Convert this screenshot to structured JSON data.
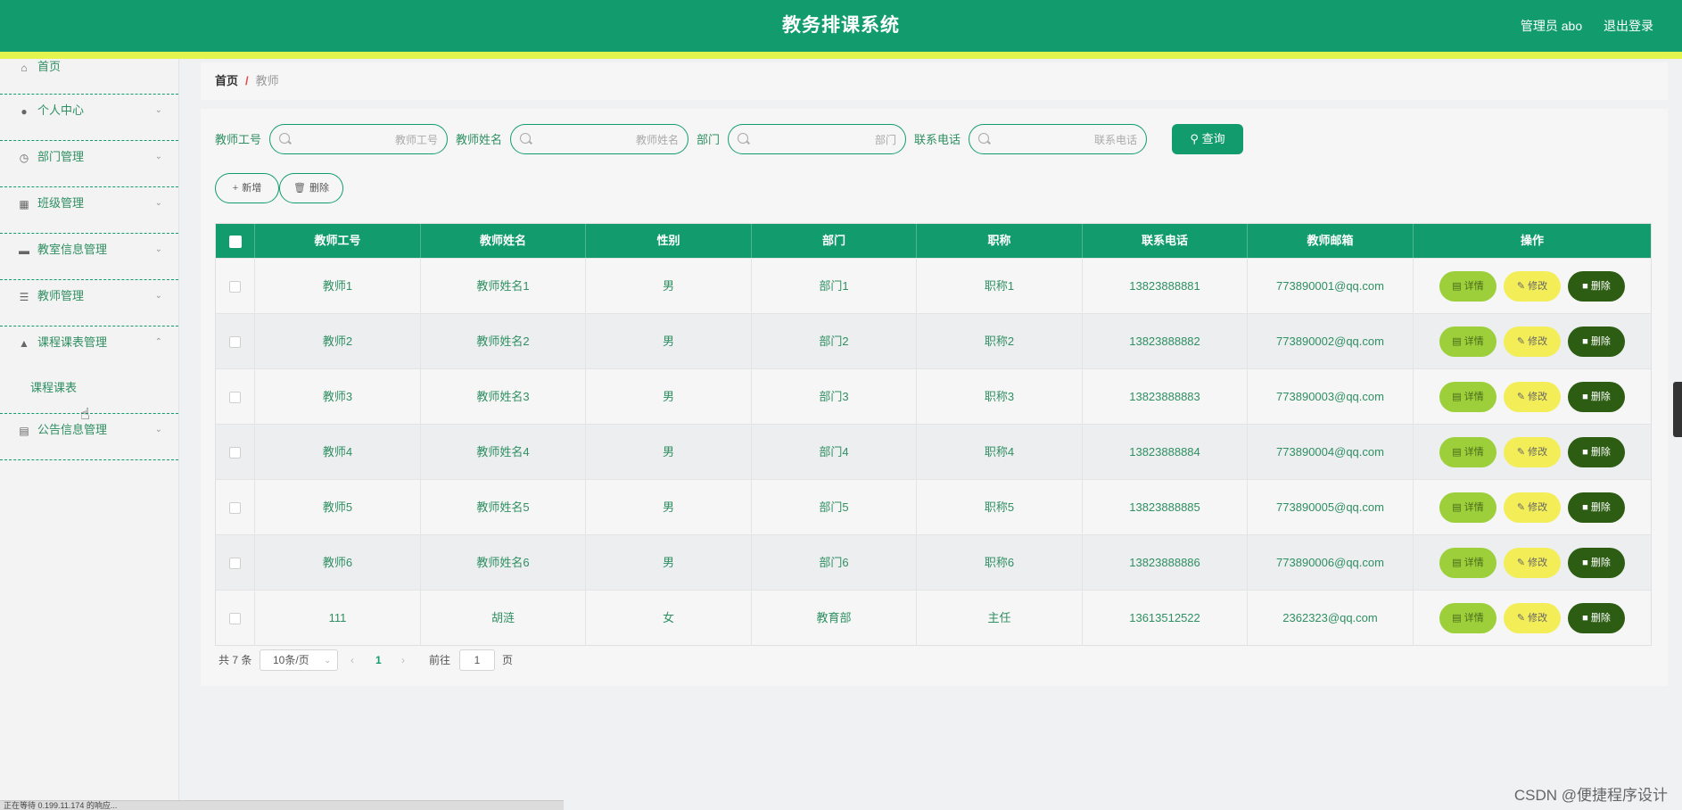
{
  "header": {
    "title": "教务排课系统",
    "user": "管理员 abo",
    "logout": "退出登录"
  },
  "sidebar": {
    "items": [
      {
        "label": "首页",
        "icon": "home-icon"
      },
      {
        "label": "个人中心",
        "icon": "user-icon"
      },
      {
        "label": "部门管理",
        "icon": "clock-icon"
      },
      {
        "label": "班级管理",
        "icon": "grid-icon"
      },
      {
        "label": "教室信息管理",
        "icon": "monitor-icon"
      },
      {
        "label": "教师管理",
        "icon": "sliders-icon"
      },
      {
        "label": "课程课表管理",
        "icon": "stamp-icon",
        "expanded": true,
        "children": [
          "课程课表"
        ]
      },
      {
        "label": "公告信息管理",
        "icon": "clipboard-icon"
      }
    ]
  },
  "breadcrumb": {
    "home": "首页",
    "separator": "/",
    "current": "教师"
  },
  "search": {
    "fields": [
      {
        "label": "教师工号",
        "placeholder": "教师工号"
      },
      {
        "label": "教师姓名",
        "placeholder": "教师姓名"
      },
      {
        "label": "部门",
        "placeholder": "部门"
      },
      {
        "label": "联系电话",
        "placeholder": "联系电话"
      }
    ],
    "query_label": "查询"
  },
  "toolbar": {
    "add_label": "新增",
    "delete_label": "删除"
  },
  "table": {
    "columns": [
      "教师工号",
      "教师姓名",
      "性别",
      "部门",
      "职称",
      "联系电话",
      "教师邮箱",
      "操作"
    ],
    "rows": [
      [
        "教师1",
        "教师姓名1",
        "男",
        "部门1",
        "职称1",
        "13823888881",
        "773890001@qq.com"
      ],
      [
        "教师2",
        "教师姓名2",
        "男",
        "部门2",
        "职称2",
        "13823888882",
        "773890002@qq.com"
      ],
      [
        "教师3",
        "教师姓名3",
        "男",
        "部门3",
        "职称3",
        "13823888883",
        "773890003@qq.com"
      ],
      [
        "教师4",
        "教师姓名4",
        "男",
        "部门4",
        "职称4",
        "13823888884",
        "773890004@qq.com"
      ],
      [
        "教师5",
        "教师姓名5",
        "男",
        "部门5",
        "职称5",
        "13823888885",
        "773890005@qq.com"
      ],
      [
        "教师6",
        "教师姓名6",
        "男",
        "部门6",
        "职称6",
        "13823888886",
        "773890006@qq.com"
      ],
      [
        "111",
        "胡涟",
        "女",
        "教育部",
        "主任",
        "13613512522",
        "2362323@qq.com"
      ]
    ],
    "row_actions": {
      "detail": "详情",
      "edit": "修改",
      "delete": "删除"
    }
  },
  "pagination": {
    "total": "共 7 条",
    "page_size": "10条/页",
    "current_page": "1",
    "goto_prefix": "前往",
    "goto_value": "1",
    "goto_suffix": "页"
  },
  "status_bar": "正在等待 0.199.11.174 的响应...",
  "watermark": "CSDN @便捷程序设计",
  "colors": {
    "primary": "#129c6e",
    "accent_strip": "#e4f44e",
    "detail_btn": "#9ccf3a",
    "edit_btn": "#f3ee58",
    "delete_btn": "#2c5d12"
  }
}
